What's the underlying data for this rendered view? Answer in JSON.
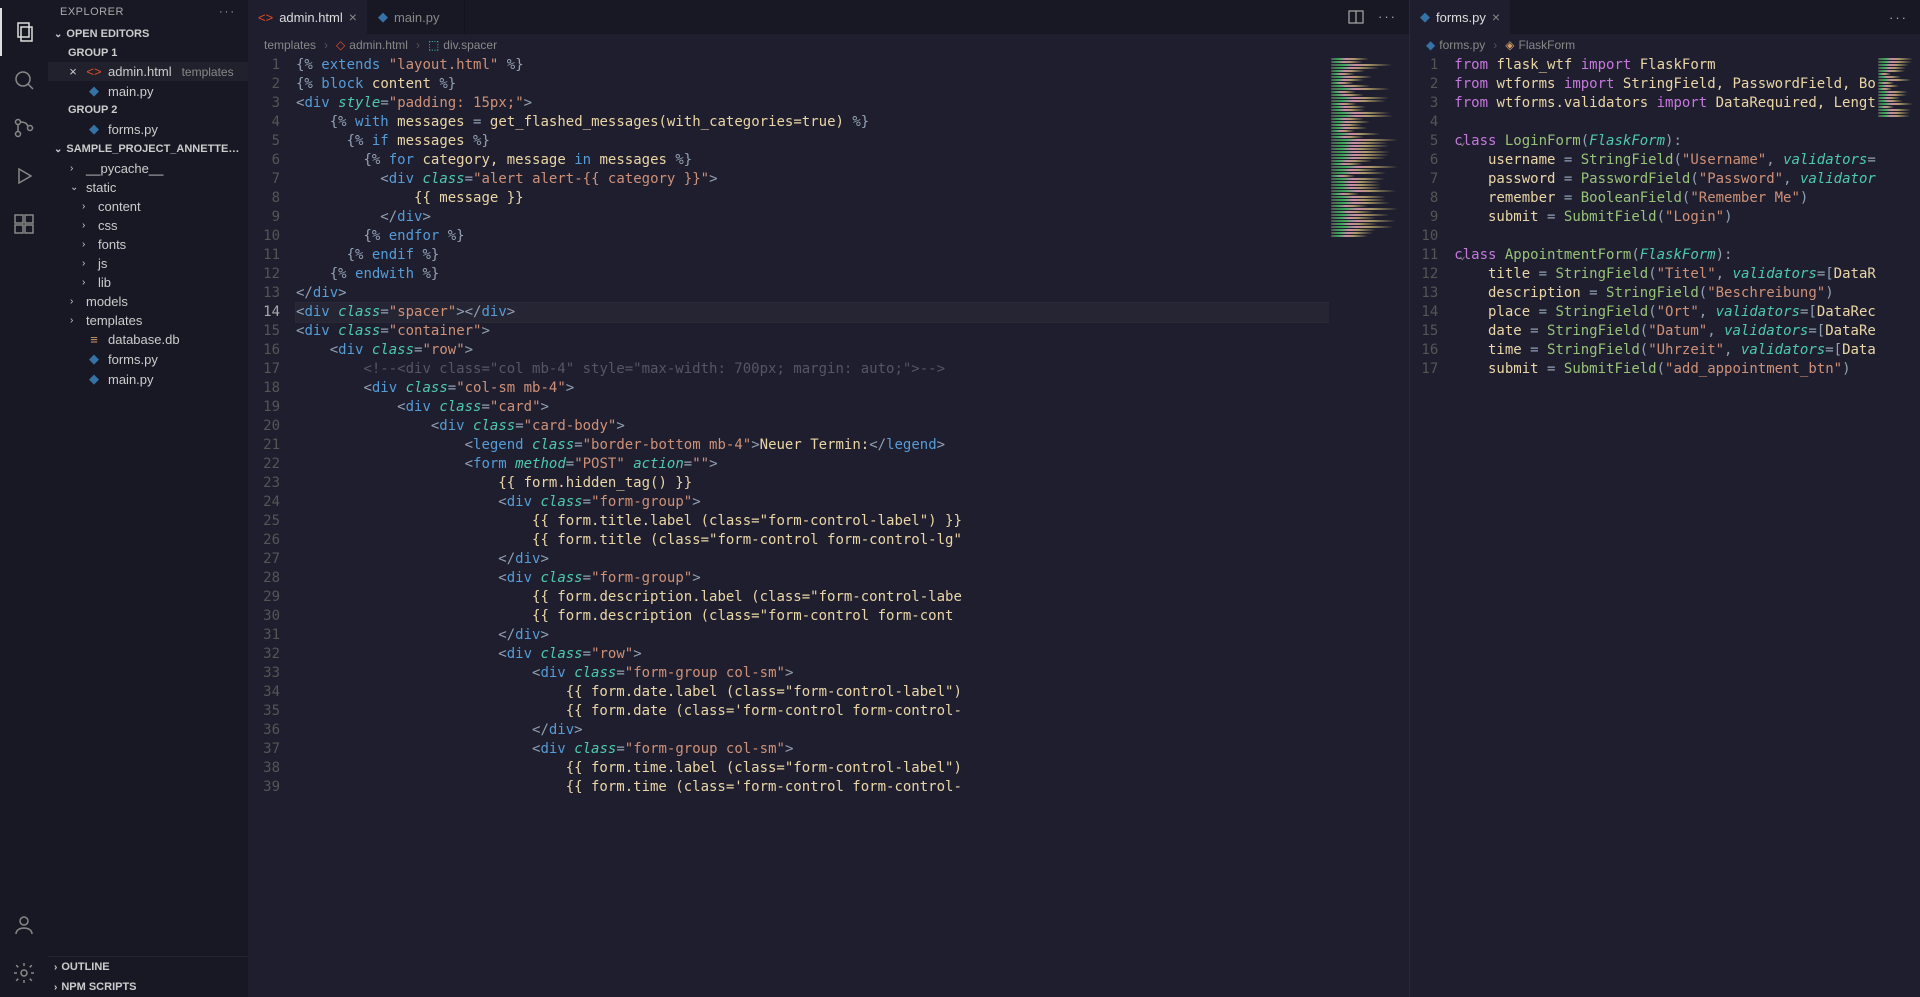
{
  "sidebar": {
    "title": "EXPLORER",
    "openEditors": "OPEN EDITORS",
    "group1": "GROUP 1",
    "group2": "GROUP 2",
    "openEditorsItems1": [
      {
        "name": "admin.html",
        "dim": "templates",
        "icon": "html",
        "close": true
      },
      {
        "name": "main.py",
        "dim": "",
        "icon": "py",
        "close": false
      }
    ],
    "openEditorsItems2": [
      {
        "name": "forms.py",
        "dim": "",
        "icon": "py",
        "close": false
      }
    ],
    "project": "SAMPLE_PROJECT_ANNETTE_KL...",
    "tree": [
      {
        "name": "__pycache__",
        "kind": "folder",
        "indent": 1,
        "chev": ">"
      },
      {
        "name": "static",
        "kind": "folder",
        "indent": 1,
        "chev": "v"
      },
      {
        "name": "content",
        "kind": "folder",
        "indent": 2,
        "chev": ">"
      },
      {
        "name": "css",
        "kind": "folder",
        "indent": 2,
        "chev": ">"
      },
      {
        "name": "fonts",
        "kind": "folder",
        "indent": 2,
        "chev": ">"
      },
      {
        "name": "js",
        "kind": "folder",
        "indent": 2,
        "chev": ">"
      },
      {
        "name": "lib",
        "kind": "folder",
        "indent": 2,
        "chev": ">"
      },
      {
        "name": "models",
        "kind": "folder",
        "indent": 1,
        "chev": ">"
      },
      {
        "name": "templates",
        "kind": "folder",
        "indent": 1,
        "chev": ">"
      },
      {
        "name": "database.db",
        "kind": "db",
        "indent": 1,
        "chev": ""
      },
      {
        "name": "forms.py",
        "kind": "py",
        "indent": 1,
        "chev": ""
      },
      {
        "name": "main.py",
        "kind": "py",
        "indent": 1,
        "chev": ""
      }
    ],
    "outline": "OUTLINE",
    "npmScripts": "NPM SCRIPTS"
  },
  "tabsLeft": [
    {
      "name": "admin.html",
      "icon": "html",
      "active": true
    },
    {
      "name": "main.py",
      "icon": "py",
      "active": false
    }
  ],
  "tabsRight": [
    {
      "name": "forms.py",
      "icon": "py",
      "active": true
    }
  ],
  "breadcrumbLeft": [
    "templates",
    "admin.html",
    "div.spacer"
  ],
  "breadcrumbRight": [
    "forms.py",
    "FlaskForm"
  ],
  "leftCode": [
    {
      "html": "<span class='p'>{%</span> <span class='tg'>extends</span> <span class='str'>\"layout.html\"</span> <span class='p'>%}</span>"
    },
    {
      "html": "<span class='p'>{%</span> <span class='tg'>block</span> <span class='txt'>content</span> <span class='p'>%}</span>"
    },
    {
      "html": "<span class='p'>&lt;</span><span class='tg'>div</span> <span class='attr'>style</span><span class='p'>=</span><span class='str'>\"padding: 15px;\"</span><span class='p'>&gt;</span>"
    },
    {
      "html": "    <span class='p'>{%</span> <span class='tg'>with</span> <span class='txt'>messages</span> <span class='p'>=</span> <span class='txt'>get_flashed_messages(with_categories=true)</span> <span class='p'>%}</span>"
    },
    {
      "html": "      <span class='p'>{%</span> <span class='tg'>if</span> <span class='txt'>messages</span> <span class='p'>%}</span>"
    },
    {
      "html": "        <span class='p'>{%</span> <span class='tg'>for</span> <span class='txt'>category, message</span> <span class='tg'>in</span> <span class='txt'>messages</span> <span class='p'>%}</span>"
    },
    {
      "html": "          <span class='p'>&lt;</span><span class='tg'>div</span> <span class='attr'>class</span><span class='p'>=</span><span class='str'>\"alert alert-{{ category }}\"</span><span class='p'>&gt;</span>"
    },
    {
      "html": "              <span class='txt'>{{ message }}</span>"
    },
    {
      "html": "          <span class='p'>&lt;/</span><span class='tg'>div</span><span class='p'>&gt;</span>"
    },
    {
      "html": "        <span class='p'>{%</span> <span class='tg'>endfor</span> <span class='p'>%}</span>"
    },
    {
      "html": "      <span class='p'>{%</span> <span class='tg'>endif</span> <span class='p'>%}</span>"
    },
    {
      "html": "    <span class='p'>{%</span> <span class='tg'>endwith</span> <span class='p'>%}</span>"
    },
    {
      "html": "<span class='p'>&lt;/</span><span class='tg'>div</span><span class='p'>&gt;</span>"
    },
    {
      "html": "<span class='p'>&lt;</span><span class='tg'>div</span> <span class='attr'>class</span><span class='p'>=</span><span class='str'>\"spacer\"</span><span class='p'>&gt;&lt;/</span><span class='tg'>div</span><span class='p'>&gt;</span>",
      "hl": true
    },
    {
      "html": "<span class='p'>&lt;</span><span class='tg'>div</span> <span class='attr'>class</span><span class='p'>=</span><span class='str'>\"container\"</span><span class='p'>&gt;</span>"
    },
    {
      "html": "    <span class='p'>&lt;</span><span class='tg'>div</span> <span class='attr'>class</span><span class='p'>=</span><span class='str'>\"row\"</span><span class='p'>&gt;</span>"
    },
    {
      "html": "        <span class='cm'>&lt;!--&lt;div class=\"col mb-4\" style=\"max-width: 700px; margin: auto;\"&gt;--&gt;</span>"
    },
    {
      "html": "        <span class='p'>&lt;</span><span class='tg'>div</span> <span class='attr'>class</span><span class='p'>=</span><span class='str'>\"col-sm mb-4\"</span><span class='p'>&gt;</span>"
    },
    {
      "html": "            <span class='p'>&lt;</span><span class='tg'>div</span> <span class='attr'>class</span><span class='p'>=</span><span class='str'>\"card\"</span><span class='p'>&gt;</span>"
    },
    {
      "html": "                <span class='p'>&lt;</span><span class='tg'>div</span> <span class='attr'>class</span><span class='p'>=</span><span class='str'>\"card-body\"</span><span class='p'>&gt;</span>"
    },
    {
      "html": "                    <span class='p'>&lt;</span><span class='tg'>legend</span> <span class='attr'>class</span><span class='p'>=</span><span class='str'>\"border-bottom mb-4\"</span><span class='p'>&gt;</span><span class='txt'>Neuer Termin:</span><span class='p'>&lt;/</span><span class='tg'>legend</span><span class='p'>&gt;</span>"
    },
    {
      "html": "                    <span class='p'>&lt;</span><span class='tg'>form</span> <span class='attr'>method</span><span class='p'>=</span><span class='str'>\"POST\"</span> <span class='attr'>action</span><span class='p'>=</span><span class='str'>\"\"</span><span class='p'>&gt;</span>"
    },
    {
      "html": "                        <span class='txt'>{{ form.hidden_tag() }}</span>"
    },
    {
      "html": "                        <span class='p'>&lt;</span><span class='tg'>div</span> <span class='attr'>class</span><span class='p'>=</span><span class='str'>\"form-group\"</span><span class='p'>&gt;</span>"
    },
    {
      "html": "                            <span class='txt'>{{ form.title.label (class=\"form-control-label\") }}</span>"
    },
    {
      "html": "                            <span class='txt'>{{ form.title (class=\"form-control form-control-lg\"</span>"
    },
    {
      "html": "                        <span class='p'>&lt;/</span><span class='tg'>div</span><span class='p'>&gt;</span>"
    },
    {
      "html": "                        <span class='p'>&lt;</span><span class='tg'>div</span> <span class='attr'>class</span><span class='p'>=</span><span class='str'>\"form-group\"</span><span class='p'>&gt;</span>"
    },
    {
      "html": "                            <span class='txt'>{{ form.description.label (class=\"form-control-labe</span>"
    },
    {
      "html": "                            <span class='txt'>{{ form.description (class=\"form-control form-cont</span>"
    },
    {
      "html": "                        <span class='p'>&lt;/</span><span class='tg'>div</span><span class='p'>&gt;</span>"
    },
    {
      "html": "                        <span class='p'>&lt;</span><span class='tg'>div</span> <span class='attr'>class</span><span class='p'>=</span><span class='str'>\"row\"</span><span class='p'>&gt;</span>"
    },
    {
      "html": "                            <span class='p'>&lt;</span><span class='tg'>div</span> <span class='attr'>class</span><span class='p'>=</span><span class='str'>\"form-group col-sm\"</span><span class='p'>&gt;</span>"
    },
    {
      "html": "                                <span class='txt'>{{ form.date.label (class=\"form-control-label\")</span>"
    },
    {
      "html": "                                <span class='txt'>{{ form.date (class='form-control form-control-</span>"
    },
    {
      "html": "                            <span class='p'>&lt;/</span><span class='tg'>div</span><span class='p'>&gt;</span>"
    },
    {
      "html": "                            <span class='p'>&lt;</span><span class='tg'>div</span> <span class='attr'>class</span><span class='p'>=</span><span class='str'>\"form-group col-sm\"</span><span class='p'>&gt;</span>"
    },
    {
      "html": "                                <span class='txt'>{{ form.time.label (class=\"form-control-label\")</span>"
    },
    {
      "html": "                                <span class='txt'>{{ form.time (class='form-control form-control-</span>"
    }
  ],
  "rightCode": [
    {
      "html": "<span class='kw'>from</span> <span class='txt'>flask_wtf</span> <span class='kw'>import</span> <span class='txt'>FlaskForm</span>"
    },
    {
      "html": "<span class='kw'>from</span> <span class='txt'>wtforms</span> <span class='kw'>import</span> <span class='txt'>StringField, PasswordField, Bo</span>"
    },
    {
      "html": "<span class='kw'>from</span> <span class='txt'>wtforms.validators</span> <span class='kw'>import</span> <span class='txt'>DataRequired, Lengt</span>"
    },
    {
      "html": ""
    },
    {
      "html": "<span class='kw'>class</span> <span class='fn'>LoginForm</span><span class='op'>(</span><span class='prm'>FlaskForm</span><span class='op'>):</span>",
      "fold": "v"
    },
    {
      "html": "    <span class='txt'>username</span> <span class='op'>=</span> <span class='fn'>StringField</span><span class='op'>(</span><span class='str'>\"Username\"</span><span class='op'>,</span> <span class='prm'>validators</span><span class='op'>=</span>"
    },
    {
      "html": "    <span class='txt'>password</span> <span class='op'>=</span> <span class='fn'>PasswordField</span><span class='op'>(</span><span class='str'>\"Password\"</span><span class='op'>,</span> <span class='prm'>validator</span>"
    },
    {
      "html": "    <span class='txt'>remember</span> <span class='op'>=</span> <span class='fn'>BooleanField</span><span class='op'>(</span><span class='str'>\"Remember Me\"</span><span class='op'>)</span>"
    },
    {
      "html": "    <span class='txt'>submit</span> <span class='op'>=</span> <span class='fn'>SubmitField</span><span class='op'>(</span><span class='str'>\"Login\"</span><span class='op'>)</span>"
    },
    {
      "html": ""
    },
    {
      "html": "<span class='kw'>class</span> <span class='fn'>AppointmentForm</span><span class='op'>(</span><span class='prm'>FlaskForm</span><span class='op'>):</span>",
      "fold": "v"
    },
    {
      "html": "    <span class='txt'>title</span> <span class='op'>=</span> <span class='fn'>StringField</span><span class='op'>(</span><span class='str'>\"Titel\"</span><span class='op'>,</span> <span class='prm'>validators</span><span class='op'>=[</span><span class='txt'>DataR</span>"
    },
    {
      "html": "    <span class='txt'>description</span> <span class='op'>=</span> <span class='fn'>StringField</span><span class='op'>(</span><span class='str'>\"Beschreibung\"</span><span class='op'>)</span>"
    },
    {
      "html": "    <span class='txt'>place</span> <span class='op'>=</span> <span class='fn'>StringField</span><span class='op'>(</span><span class='str'>\"Ort\"</span><span class='op'>,</span> <span class='prm'>validators</span><span class='op'>=[</span><span class='txt'>DataRec</span>"
    },
    {
      "html": "    <span class='txt'>date</span> <span class='op'>=</span> <span class='fn'>StringField</span><span class='op'>(</span><span class='str'>\"Datum\"</span><span class='op'>,</span> <span class='prm'>validators</span><span class='op'>=[</span><span class='txt'>DataRe</span>"
    },
    {
      "html": "    <span class='txt'>time</span> <span class='op'>=</span> <span class='fn'>StringField</span><span class='op'>(</span><span class='str'>\"Uhrzeit\"</span><span class='op'>,</span> <span class='prm'>validators</span><span class='op'>=[</span><span class='txt'>Data</span>"
    },
    {
      "html": "    <span class='txt'>submit</span> <span class='op'>=</span> <span class='fn'>SubmitField</span><span class='op'>(</span><span class='str'>\"add_appointment_btn\"</span><span class='op'>)</span>"
    }
  ],
  "leftStartLine": 1,
  "leftCurrentLine": 14,
  "rightStartLine": 1
}
